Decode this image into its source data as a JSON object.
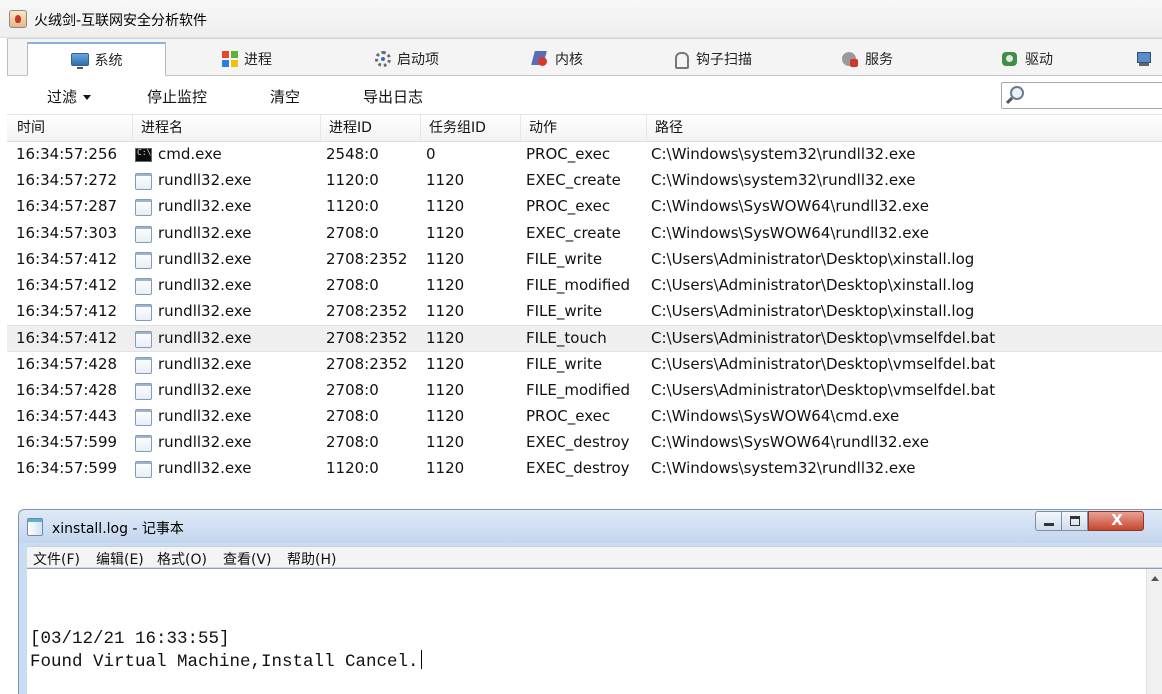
{
  "app": {
    "title": "火绒剑-互联网安全分析软件"
  },
  "tabs": [
    {
      "label": "系统",
      "icon": "monitor-icon",
      "active": true
    },
    {
      "label": "进程",
      "icon": "windows-flag-icon"
    },
    {
      "label": "启动项",
      "icon": "gear-icon"
    },
    {
      "label": "内核",
      "icon": "kernel-icon"
    },
    {
      "label": "钩子扫描",
      "icon": "hook-icon"
    },
    {
      "label": "服务",
      "icon": "service-icon"
    },
    {
      "label": "驱动",
      "icon": "driver-icon"
    },
    {
      "label": "",
      "icon": "network-icon"
    }
  ],
  "toolbar": {
    "filter_label": "过滤",
    "stop_label": "停止监控",
    "clear_label": "清空",
    "export_label": "导出日志",
    "search_value": ""
  },
  "table": {
    "columns": [
      "时间",
      "进程名",
      "进程ID",
      "任务组ID",
      "动作",
      "路径"
    ],
    "selected_row": 7,
    "rows": [
      {
        "time": "16:34:57:256",
        "icon": "cmd-icon",
        "name": "cmd.exe",
        "pid": "2548:0",
        "tgid": "0",
        "action": "PROC_exec",
        "path": "C:\\Windows\\system32\\rundll32.exe"
      },
      {
        "time": "16:34:57:272",
        "icon": "file-icon",
        "name": "rundll32.exe",
        "pid": "1120:0",
        "tgid": "1120",
        "action": "EXEC_create",
        "path": "C:\\Windows\\system32\\rundll32.exe"
      },
      {
        "time": "16:34:57:287",
        "icon": "file-icon",
        "name": "rundll32.exe",
        "pid": "1120:0",
        "tgid": "1120",
        "action": "PROC_exec",
        "path": "C:\\Windows\\SysWOW64\\rundll32.exe"
      },
      {
        "time": "16:34:57:303",
        "icon": "file-icon",
        "name": "rundll32.exe",
        "pid": "2708:0",
        "tgid": "1120",
        "action": "EXEC_create",
        "path": "C:\\Windows\\SysWOW64\\rundll32.exe"
      },
      {
        "time": "16:34:57:412",
        "icon": "file-icon",
        "name": "rundll32.exe",
        "pid": "2708:2352",
        "tgid": "1120",
        "action": "FILE_write",
        "path": "C:\\Users\\Administrator\\Desktop\\xinstall.log"
      },
      {
        "time": "16:34:57:412",
        "icon": "file-icon",
        "name": "rundll32.exe",
        "pid": "2708:0",
        "tgid": "1120",
        "action": "FILE_modified",
        "path": "C:\\Users\\Administrator\\Desktop\\xinstall.log"
      },
      {
        "time": "16:34:57:412",
        "icon": "file-icon",
        "name": "rundll32.exe",
        "pid": "2708:2352",
        "tgid": "1120",
        "action": "FILE_write",
        "path": "C:\\Users\\Administrator\\Desktop\\xinstall.log"
      },
      {
        "time": "16:34:57:412",
        "icon": "file-icon",
        "name": "rundll32.exe",
        "pid": "2708:2352",
        "tgid": "1120",
        "action": "FILE_touch",
        "path": "C:\\Users\\Administrator\\Desktop\\vmselfdel.bat"
      },
      {
        "time": "16:34:57:428",
        "icon": "file-icon",
        "name": "rundll32.exe",
        "pid": "2708:2352",
        "tgid": "1120",
        "action": "FILE_write",
        "path": "C:\\Users\\Administrator\\Desktop\\vmselfdel.bat"
      },
      {
        "time": "16:34:57:428",
        "icon": "file-icon",
        "name": "rundll32.exe",
        "pid": "2708:0",
        "tgid": "1120",
        "action": "FILE_modified",
        "path": "C:\\Users\\Administrator\\Desktop\\vmselfdel.bat"
      },
      {
        "time": "16:34:57:443",
        "icon": "file-icon",
        "name": "rundll32.exe",
        "pid": "2708:0",
        "tgid": "1120",
        "action": "PROC_exec",
        "path": "C:\\Windows\\SysWOW64\\cmd.exe"
      },
      {
        "time": "16:34:57:599",
        "icon": "file-icon",
        "name": "rundll32.exe",
        "pid": "2708:0",
        "tgid": "1120",
        "action": "EXEC_destroy",
        "path": "C:\\Windows\\SysWOW64\\rundll32.exe"
      },
      {
        "time": "16:34:57:599",
        "icon": "file-icon",
        "name": "rundll32.exe",
        "pid": "1120:0",
        "tgid": "1120",
        "action": "EXEC_destroy",
        "path": "C:\\Windows\\system32\\rundll32.exe"
      }
    ]
  },
  "notepad": {
    "title": "xinstall.log - 记事本",
    "menu": [
      "文件(F)",
      "编辑(E)",
      "格式(O)",
      "查看(V)",
      "帮助(H)"
    ],
    "close_glyph": "X",
    "lines": [
      "[03/12/21 16:33:55]",
      "Found Virtual Machine,Install Cancel."
    ]
  }
}
